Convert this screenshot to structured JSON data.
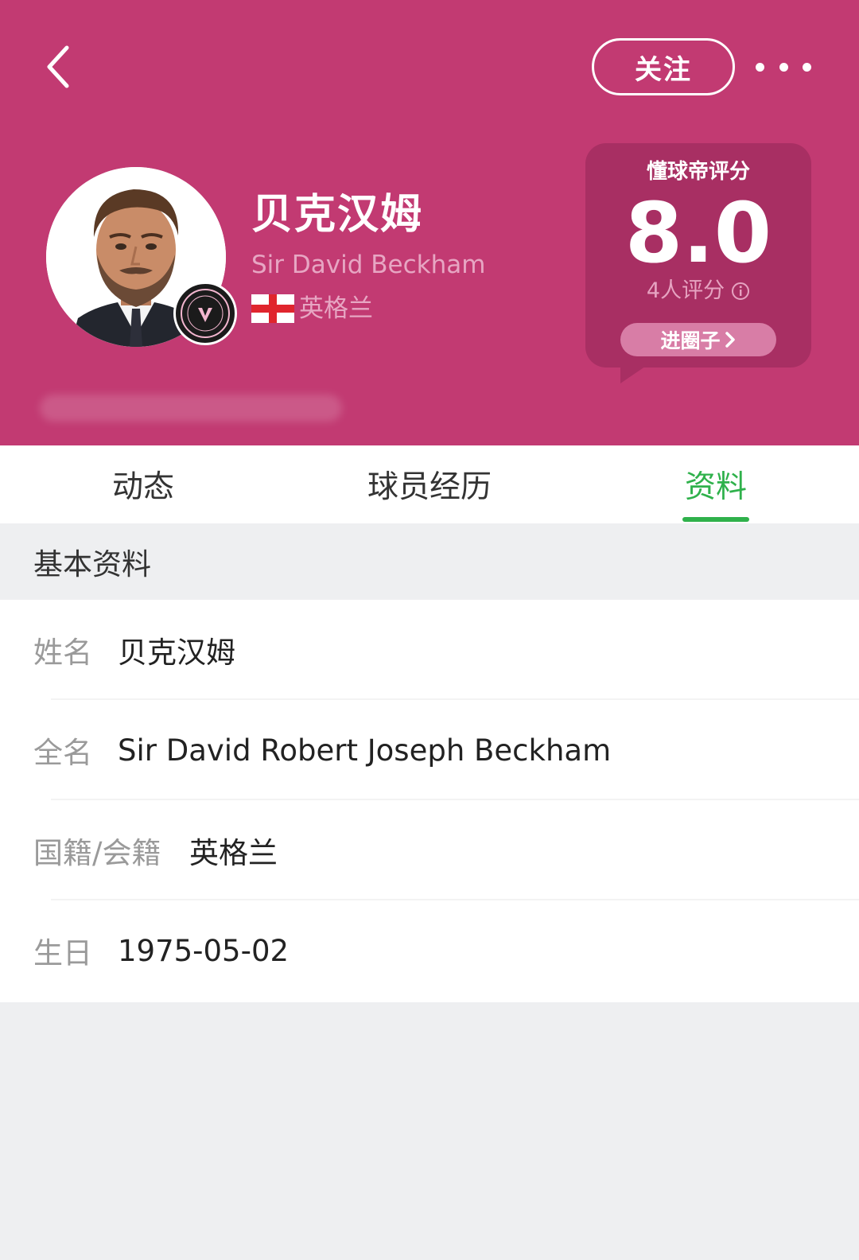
{
  "header": {
    "follow_label": "关注",
    "player_name": "贝克汉姆",
    "player_en_name": "Sir David Beckham",
    "nationality": "英格兰",
    "background_color": "#c23a72"
  },
  "rating": {
    "title": "懂球帝评分",
    "score": "8.0",
    "count": "4人评分",
    "circle_button": "进圈子",
    "circle_button_arrow": "›"
  },
  "tabs": [
    {
      "label": "动态",
      "active": false
    },
    {
      "label": "球员经历",
      "active": false
    },
    {
      "label": "资料",
      "active": true
    }
  ],
  "active_tab_color": "#2fb14b",
  "section": {
    "title": "基本资料",
    "rows": [
      {
        "label": "姓名",
        "value": "贝克汉姆"
      },
      {
        "label": "全名",
        "value": "Sir David Robert Joseph Beckham"
      },
      {
        "label": "国籍/会籍",
        "value": "英格兰"
      },
      {
        "label": "生日",
        "value": "1975-05-02"
      }
    ]
  },
  "icons": {
    "back": "chevron-left-icon",
    "more": "more-dots-icon",
    "flag": "england-flag-icon",
    "info": "info-icon",
    "badge": "club-badge-icon"
  }
}
